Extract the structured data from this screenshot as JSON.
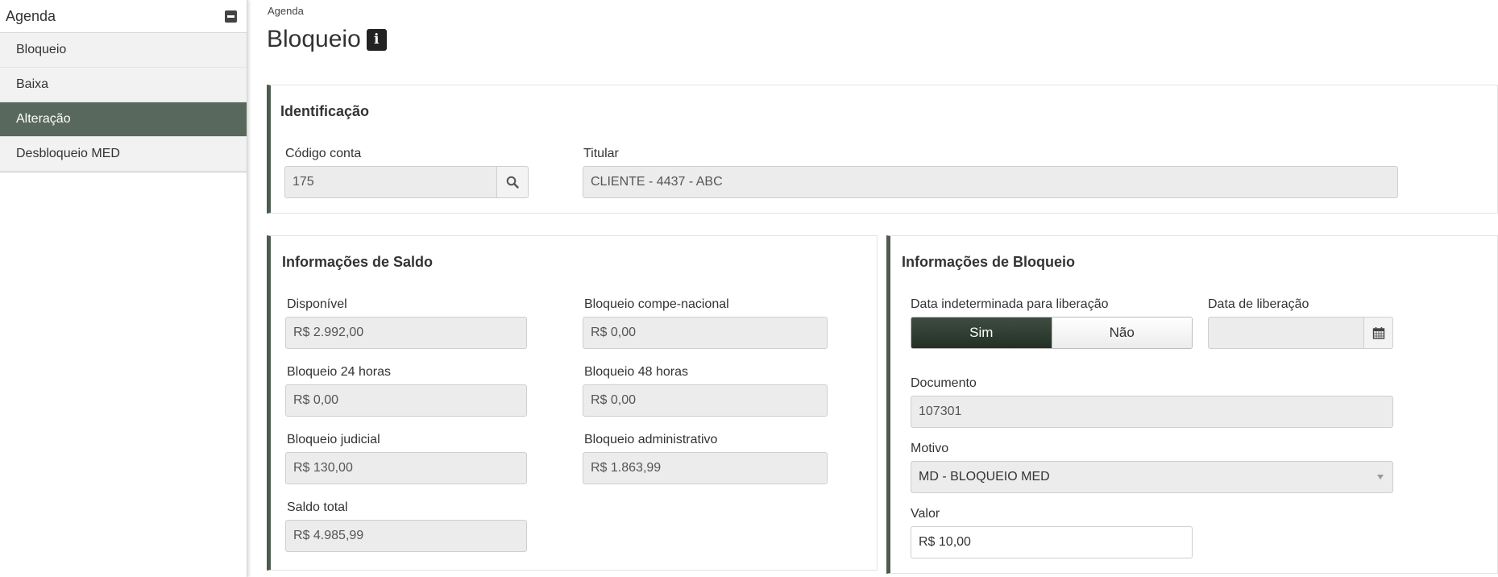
{
  "sidebar": {
    "title": "Agenda",
    "items": [
      {
        "label": "Bloqueio"
      },
      {
        "label": "Baixa"
      },
      {
        "label": "Alteração"
      },
      {
        "label": "Desbloqueio MED"
      }
    ]
  },
  "breadcrumb": "Agenda",
  "page_title": "Bloqueio",
  "identificacao": {
    "title": "Identificação",
    "codigo_label": "Código conta",
    "codigo_value": "175",
    "titular_label": "Titular",
    "titular_value": "CLIENTE - 4437 - ABC"
  },
  "saldo": {
    "title": "Informações de Saldo",
    "disponivel_label": "Disponível",
    "disponivel_value": "R$ 2.992,00",
    "compe_label": "Bloqueio compe-nacional",
    "compe_value": "R$ 0,00",
    "b24_label": "Bloqueio 24 horas",
    "b24_value": "R$ 0,00",
    "b48_label": "Bloqueio 48 horas",
    "b48_value": "R$ 0,00",
    "judicial_label": "Bloqueio judicial",
    "judicial_value": "R$ 130,00",
    "admin_label": "Bloqueio administrativo",
    "admin_value": "R$ 1.863,99",
    "total_label": "Saldo total",
    "total_value": "R$ 4.985,99"
  },
  "bloqueio": {
    "title": "Informações de Bloqueio",
    "indeterminada_label": "Data indeterminada para liberação",
    "toggle_yes": "Sim",
    "toggle_no": "Não",
    "toggle_selected": "Sim",
    "data_label": "Data de liberação",
    "data_value": "",
    "documento_label": "Documento",
    "documento_value": "107301",
    "motivo_label": "Motivo",
    "motivo_value": "MD - BLOQUEIO MED",
    "valor_label": "Valor",
    "valor_value": "R$ 10,00"
  },
  "colors": {
    "accent": "#59685c",
    "toggle_active": "#2f3b32"
  }
}
